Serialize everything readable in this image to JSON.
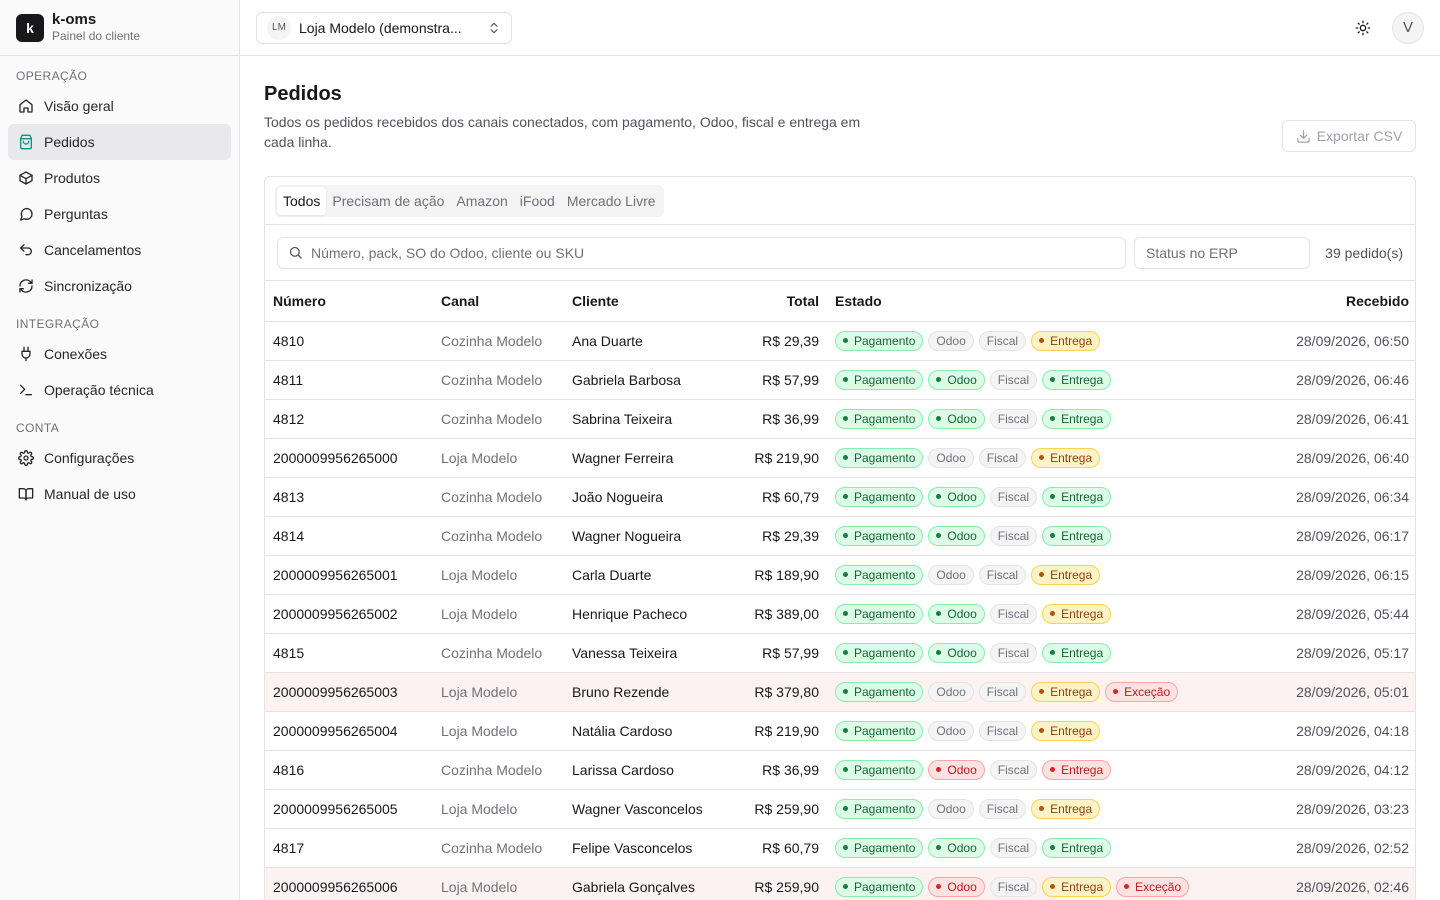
{
  "brand": {
    "logo_letter": "k",
    "name": "k-oms",
    "subtitle": "Painel do cliente"
  },
  "sidebar": {
    "sections": [
      {
        "title": "OPERAÇÃO",
        "items": [
          {
            "label": "Visão geral",
            "icon": "home-icon"
          },
          {
            "label": "Pedidos",
            "icon": "shopping-bag-icon",
            "active": true
          },
          {
            "label": "Produtos",
            "icon": "package-icon"
          },
          {
            "label": "Perguntas",
            "icon": "message-circle-icon"
          },
          {
            "label": "Cancelamentos",
            "icon": "undo-icon"
          },
          {
            "label": "Sincronização",
            "icon": "refresh-icon"
          }
        ]
      },
      {
        "title": "INTEGRAÇÃO",
        "items": [
          {
            "label": "Conexões",
            "icon": "plug-icon"
          },
          {
            "label": "Operação técnica",
            "icon": "terminal-icon"
          }
        ]
      },
      {
        "title": "CONTA",
        "items": [
          {
            "label": "Configurações",
            "icon": "gear-icon"
          },
          {
            "label": "Manual de uso",
            "icon": "book-icon"
          }
        ]
      }
    ]
  },
  "topbar": {
    "store_initials": "LM",
    "store_name": "Loja Modelo (demonstra...",
    "avatar_letter": "V"
  },
  "page": {
    "title": "Pedidos",
    "description": "Todos os pedidos recebidos dos canais conectados, com pagamento, Odoo, fiscal e entrega em cada linha.",
    "export_label": "Exportar CSV"
  },
  "tabs": [
    "Todos",
    "Precisam de ação",
    "Amazon",
    "iFood",
    "Mercado Livre"
  ],
  "active_tab": 0,
  "filters": {
    "search_placeholder": "Número, pack, SO do Odoo, cliente ou SKU",
    "status_placeholder": "Status no ERP",
    "count": "39 pedido(s)"
  },
  "table": {
    "headers": {
      "number": "Número",
      "channel": "Canal",
      "customer": "Cliente",
      "total": "Total",
      "state": "Estado",
      "received": "Recebido"
    },
    "rows": [
      {
        "number": "4810",
        "channel": "Cozinha Modelo",
        "customer": "Ana Duarte",
        "total": "R$ 29,39",
        "badges": [
          [
            "Pagamento",
            "green"
          ],
          [
            "Odoo",
            "gray"
          ],
          [
            "Fiscal",
            "gray"
          ],
          [
            "Entrega",
            "amber"
          ]
        ],
        "received": "28/09/2026, 06:50"
      },
      {
        "number": "4811",
        "channel": "Cozinha Modelo",
        "customer": "Gabriela Barbosa",
        "total": "R$ 57,99",
        "badges": [
          [
            "Pagamento",
            "green"
          ],
          [
            "Odoo",
            "green"
          ],
          [
            "Fiscal",
            "gray"
          ],
          [
            "Entrega",
            "green"
          ]
        ],
        "received": "28/09/2026, 06:46"
      },
      {
        "number": "4812",
        "channel": "Cozinha Modelo",
        "customer": "Sabrina Teixeira",
        "total": "R$ 36,99",
        "badges": [
          [
            "Pagamento",
            "green"
          ],
          [
            "Odoo",
            "green"
          ],
          [
            "Fiscal",
            "gray"
          ],
          [
            "Entrega",
            "green"
          ]
        ],
        "received": "28/09/2026, 06:41"
      },
      {
        "number": "2000009956265000",
        "channel": "Loja Modelo",
        "customer": "Wagner Ferreira",
        "total": "R$ 219,90",
        "badges": [
          [
            "Pagamento",
            "green"
          ],
          [
            "Odoo",
            "gray"
          ],
          [
            "Fiscal",
            "gray"
          ],
          [
            "Entrega",
            "amber"
          ]
        ],
        "received": "28/09/2026, 06:40"
      },
      {
        "number": "4813",
        "channel": "Cozinha Modelo",
        "customer": "João Nogueira",
        "total": "R$ 60,79",
        "badges": [
          [
            "Pagamento",
            "green"
          ],
          [
            "Odoo",
            "green"
          ],
          [
            "Fiscal",
            "gray"
          ],
          [
            "Entrega",
            "green"
          ]
        ],
        "received": "28/09/2026, 06:34"
      },
      {
        "number": "4814",
        "channel": "Cozinha Modelo",
        "customer": "Wagner Nogueira",
        "total": "R$ 29,39",
        "badges": [
          [
            "Pagamento",
            "green"
          ],
          [
            "Odoo",
            "green"
          ],
          [
            "Fiscal",
            "gray"
          ],
          [
            "Entrega",
            "green"
          ]
        ],
        "received": "28/09/2026, 06:17"
      },
      {
        "number": "2000009956265001",
        "channel": "Loja Modelo",
        "customer": "Carla Duarte",
        "total": "R$ 189,90",
        "badges": [
          [
            "Pagamento",
            "green"
          ],
          [
            "Odoo",
            "gray"
          ],
          [
            "Fiscal",
            "gray"
          ],
          [
            "Entrega",
            "amber"
          ]
        ],
        "received": "28/09/2026, 06:15"
      },
      {
        "number": "2000009956265002",
        "channel": "Loja Modelo",
        "customer": "Henrique Pacheco",
        "total": "R$ 389,00",
        "badges": [
          [
            "Pagamento",
            "green"
          ],
          [
            "Odoo",
            "green"
          ],
          [
            "Fiscal",
            "gray"
          ],
          [
            "Entrega",
            "amber"
          ]
        ],
        "received": "28/09/2026, 05:44"
      },
      {
        "number": "4815",
        "channel": "Cozinha Modelo",
        "customer": "Vanessa Teixeira",
        "total": "R$ 57,99",
        "badges": [
          [
            "Pagamento",
            "green"
          ],
          [
            "Odoo",
            "green"
          ],
          [
            "Fiscal",
            "gray"
          ],
          [
            "Entrega",
            "green"
          ]
        ],
        "received": "28/09/2026, 05:17"
      },
      {
        "number": "2000009956265003",
        "channel": "Loja Modelo",
        "customer": "Bruno Rezende",
        "total": "R$ 379,80",
        "exception": true,
        "badges": [
          [
            "Pagamento",
            "green"
          ],
          [
            "Odoo",
            "gray"
          ],
          [
            "Fiscal",
            "gray"
          ],
          [
            "Entrega",
            "amber"
          ],
          [
            "Exceção",
            "red"
          ]
        ],
        "received": "28/09/2026, 05:01"
      },
      {
        "number": "2000009956265004",
        "channel": "Loja Modelo",
        "customer": "Natália Cardoso",
        "total": "R$ 219,90",
        "badges": [
          [
            "Pagamento",
            "green"
          ],
          [
            "Odoo",
            "gray"
          ],
          [
            "Fiscal",
            "gray"
          ],
          [
            "Entrega",
            "amber"
          ]
        ],
        "received": "28/09/2026, 04:18"
      },
      {
        "number": "4816",
        "channel": "Cozinha Modelo",
        "customer": "Larissa Cardoso",
        "total": "R$ 36,99",
        "badges": [
          [
            "Pagamento",
            "green"
          ],
          [
            "Odoo",
            "red"
          ],
          [
            "Fiscal",
            "gray"
          ],
          [
            "Entrega",
            "red"
          ]
        ],
        "received": "28/09/2026, 04:12"
      },
      {
        "number": "2000009956265005",
        "channel": "Loja Modelo",
        "customer": "Wagner Vasconcelos",
        "total": "R$ 259,90",
        "badges": [
          [
            "Pagamento",
            "green"
          ],
          [
            "Odoo",
            "gray"
          ],
          [
            "Fiscal",
            "gray"
          ],
          [
            "Entrega",
            "amber"
          ]
        ],
        "received": "28/09/2026, 03:23"
      },
      {
        "number": "4817",
        "channel": "Cozinha Modelo",
        "customer": "Felipe Vasconcelos",
        "total": "R$ 60,79",
        "badges": [
          [
            "Pagamento",
            "green"
          ],
          [
            "Odoo",
            "green"
          ],
          [
            "Fiscal",
            "gray"
          ],
          [
            "Entrega",
            "green"
          ]
        ],
        "received": "28/09/2026, 02:52"
      },
      {
        "number": "2000009956265006",
        "channel": "Loja Modelo",
        "customer": "Gabriela Gonçalves",
        "total": "R$ 259,90",
        "exception": true,
        "badges": [
          [
            "Pagamento",
            "green"
          ],
          [
            "Odoo",
            "red"
          ],
          [
            "Fiscal",
            "gray"
          ],
          [
            "Entrega",
            "amber"
          ],
          [
            "Exceção",
            "red"
          ]
        ],
        "received": "28/09/2026, 02:46"
      }
    ]
  },
  "colors": {
    "accent": "#18181b",
    "active_nav_bg": "#e9e9ec",
    "ok": "#15803d",
    "warn": "#b45309",
    "error": "#dc2626",
    "exception_row": "#fdf2f2"
  }
}
